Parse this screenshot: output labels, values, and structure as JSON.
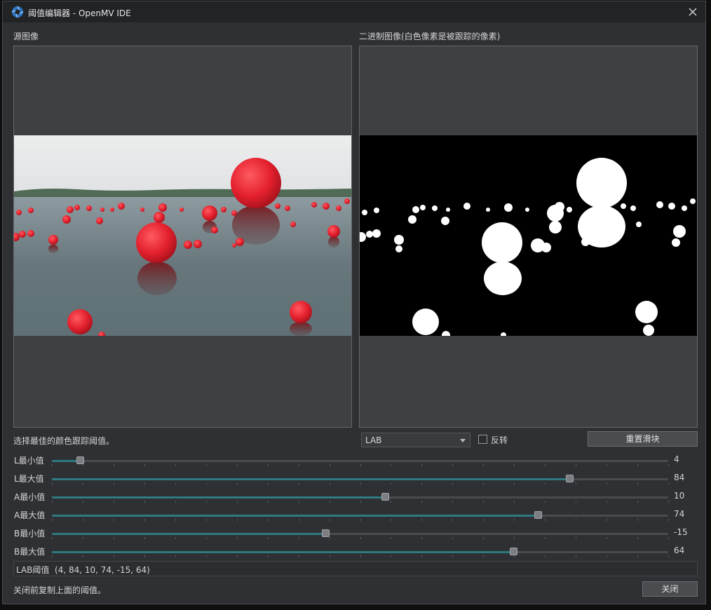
{
  "window": {
    "title": "阈值编辑器 - OpenMV IDE",
    "icon": "openmv-aperture-icon",
    "close_icon": "close-icon"
  },
  "source_pane": {
    "label": "源图像"
  },
  "binary_pane": {
    "label": "二进制图像(白色像素是被跟踪的像素)"
  },
  "instruction": "选择最佳的颜色跟踪阈值。",
  "color_space": {
    "selected": "LAB"
  },
  "invert": {
    "label": "反转",
    "checked": false
  },
  "reset_button": {
    "label": "重置滑块"
  },
  "sliders": [
    {
      "label": "L最小值",
      "value": "4",
      "fraction": 0.045
    },
    {
      "label": "L最大值",
      "value": "84",
      "fraction": 0.84
    },
    {
      "label": "A最小值",
      "value": "10",
      "fraction": 0.54
    },
    {
      "label": "A最大值",
      "value": "74",
      "fraction": 0.788
    },
    {
      "label": "B最小值",
      "value": "-15",
      "fraction": 0.444
    },
    {
      "label": "B最大值",
      "value": "64",
      "fraction": 0.749
    }
  ],
  "result": {
    "label": "LAB阈值",
    "value": "(4, 84, 10, 74, -15, 64)"
  },
  "footer": {
    "note": "关闭前复制上面的阈值。",
    "close_button": "关闭"
  },
  "colors": {
    "accent": "#2e7a80",
    "ball_red": "#e52433",
    "water": "#5a6a70",
    "sky": "#e7e8ea"
  }
}
